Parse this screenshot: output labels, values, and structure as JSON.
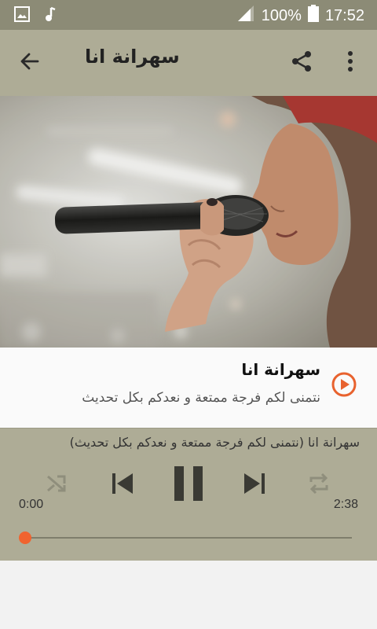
{
  "status_bar": {
    "battery_text": "100%",
    "time": "17:52"
  },
  "app_bar": {
    "title": "سهرانة انا"
  },
  "track": {
    "title": "سهرانة انا",
    "subtitle": "نتمنى لكم فرجة ممتعة و نعدكم بكل تحديث",
    "accent_color": "#e8622e"
  },
  "player": {
    "now_playing": "سهرانة انا (نتمنى لكم فرجة ممتعة و نعدكم بكل تحديث)",
    "elapsed": "0:00",
    "duration": "2:38",
    "progress": 0.0,
    "seek_color": "#f0632f"
  },
  "icons": {
    "status": [
      "image-icon",
      "music-note-icon",
      "signal-icon",
      "battery-icon"
    ],
    "app_bar": [
      "back-arrow-icon",
      "share-icon",
      "more-vert-icon"
    ],
    "controls": [
      "shuffle-icon",
      "skip-previous-icon",
      "pause-icon",
      "skip-next-icon",
      "repeat-icon"
    ],
    "track": [
      "play-circle-icon"
    ]
  }
}
